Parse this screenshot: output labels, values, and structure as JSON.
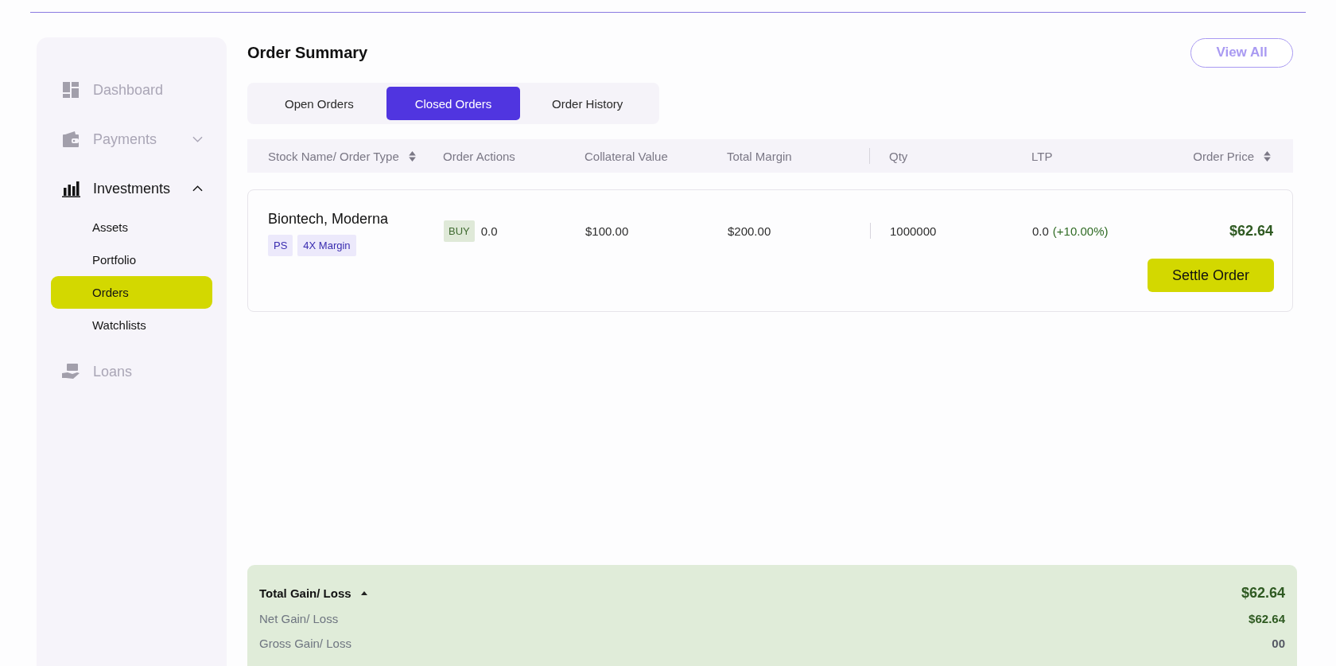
{
  "sidebar": {
    "items": [
      {
        "label": "Dashboard",
        "kind": "dashboard",
        "selected": false
      },
      {
        "label": "Payments",
        "kind": "wallet",
        "selected": false,
        "expanded": false
      },
      {
        "label": "Investments",
        "kind": "chart",
        "selected": true,
        "expanded": true,
        "children": [
          {
            "label": "Assets",
            "selected": false
          },
          {
            "label": "Portfolio",
            "selected": false
          },
          {
            "label": "Orders",
            "selected": true
          },
          {
            "label": "Watchlists",
            "selected": false
          }
        ]
      },
      {
        "label": "Loans",
        "kind": "loan",
        "selected": false
      }
    ]
  },
  "title": "Order Summary",
  "view_all": "View All",
  "tabs": [
    {
      "label": "Open Orders",
      "selected": false
    },
    {
      "label": "Closed Orders",
      "selected": true
    },
    {
      "label": "Order History",
      "selected": false
    }
  ],
  "table": {
    "columns": [
      {
        "label": "Stock Name/ Order Type",
        "sortable": true
      },
      {
        "label": "Order Actions",
        "sortable": false
      },
      {
        "label": "Collateral Value",
        "sortable": false
      },
      {
        "label": "Total Margin",
        "sortable": false
      },
      {
        "label": "Qty",
        "sortable": false
      },
      {
        "label": "LTP",
        "sortable": false
      },
      {
        "label": "Order Price",
        "sortable": true
      }
    ],
    "rows": [
      {
        "name": "Biontech, Moderna",
        "tags": [
          "PS",
          "4X Margin"
        ],
        "side": "BUY",
        "action_value": "0.0",
        "collateral": "$100.00",
        "margin": "$200.00",
        "qty": "1000000",
        "ltp": "0.0",
        "ltp_change": "(+10.00%)",
        "price": "$62.64",
        "button": "Settle Order"
      }
    ]
  },
  "summary": {
    "title": "Total Gain/ Loss",
    "expanded": true,
    "total": "$62.64",
    "lines": [
      {
        "label": "Net Gain/ Loss",
        "value": "$62.64",
        "kind": "gain"
      },
      {
        "label": "Gross Gain/ Loss",
        "value": "00",
        "kind": "neutral"
      }
    ]
  }
}
